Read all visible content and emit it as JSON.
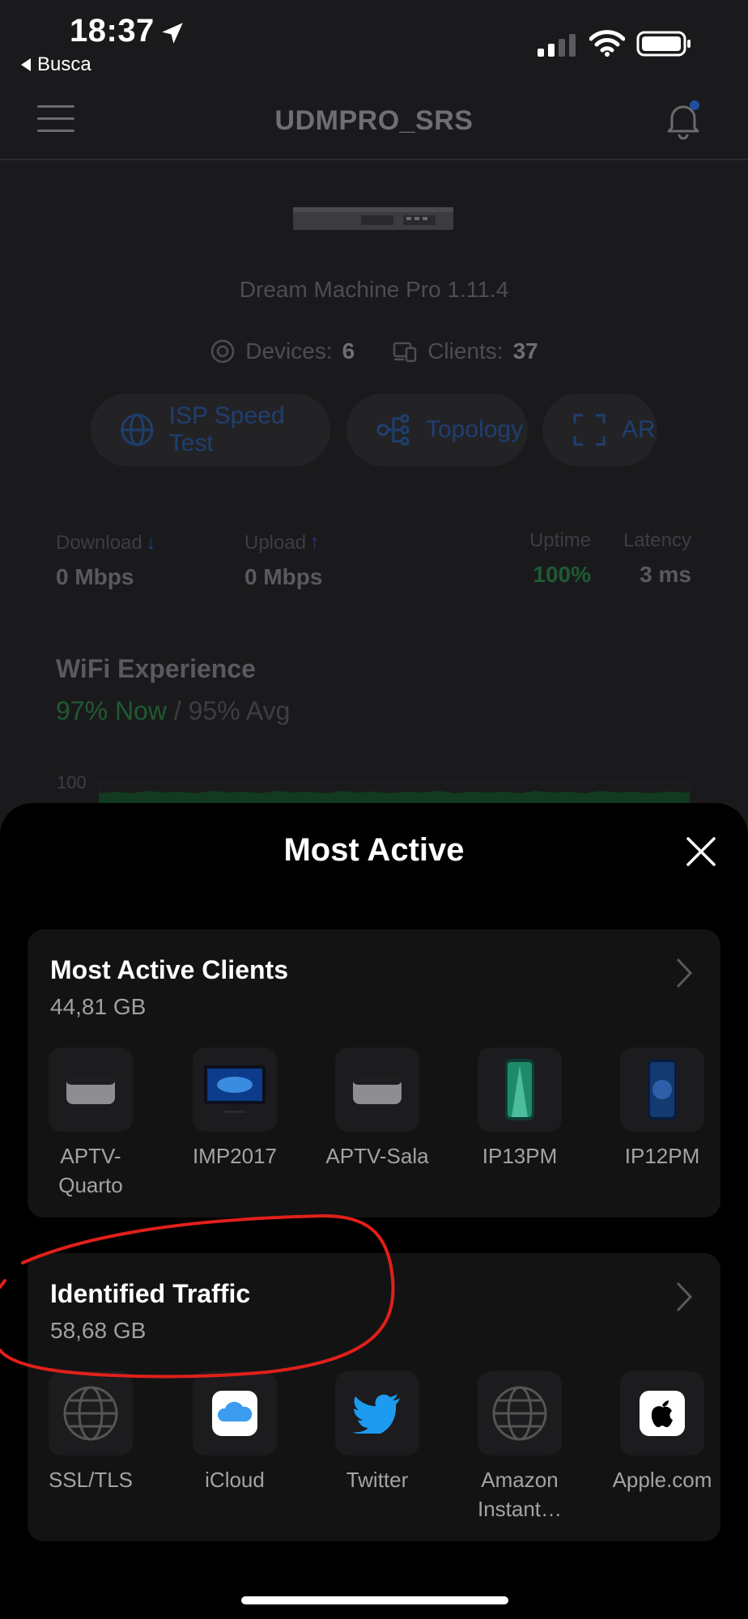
{
  "status_bar": {
    "time": "18:37",
    "back_label": "Busca"
  },
  "nav": {
    "title": "UDMPRO_SRS"
  },
  "device": {
    "model": "Dream Machine Pro 1.11.4",
    "devices_label": "Devices:",
    "devices_count": "6",
    "clients_label": "Clients:",
    "clients_count": "37"
  },
  "actions": {
    "speedtest": "ISP Speed Test",
    "topology": "Topology",
    "ar": "AR"
  },
  "metrics": {
    "download_label": "Download",
    "download_value": "0 Mbps",
    "upload_label": "Upload",
    "upload_value": "0 Mbps",
    "uptime_label": "Uptime",
    "uptime_value": "100%",
    "latency_label": "Latency",
    "latency_value": "3 ms"
  },
  "wifi": {
    "title": "WiFi Experience",
    "now": "97% Now",
    "sep": " / ",
    "avg": "95% Avg",
    "chart_max": "100"
  },
  "sheet": {
    "title": "Most Active",
    "clients_card": {
      "title": "Most Active Clients",
      "total": "44,81 GB",
      "items": [
        {
          "label": "APTV-Quarto",
          "icon": "apple-tv-icon"
        },
        {
          "label": "IMP2017",
          "icon": "imac-pro-icon"
        },
        {
          "label": "APTV-Sala",
          "icon": "apple-tv-icon"
        },
        {
          "label": "IP13PM",
          "icon": "iphone-13-pro-max-icon"
        },
        {
          "label": "IP12PM",
          "icon": "iphone-12-pro-max-icon"
        }
      ]
    },
    "traffic_card": {
      "title": "Identified Traffic",
      "total": "58,68 GB",
      "items": [
        {
          "label": "SSL/TLS",
          "icon": "globe-icon"
        },
        {
          "label": "iCloud",
          "icon": "icloud-icon"
        },
        {
          "label": "Twitter",
          "icon": "twitter-icon"
        },
        {
          "label": "Amazon Instant…",
          "icon": "globe-icon"
        },
        {
          "label": "Apple.com",
          "icon": "apple-icon"
        }
      ]
    }
  },
  "colors": {
    "accent_blue": "#1f3f70",
    "green": "#1f5a32",
    "annotation_red": "#e0201a"
  }
}
